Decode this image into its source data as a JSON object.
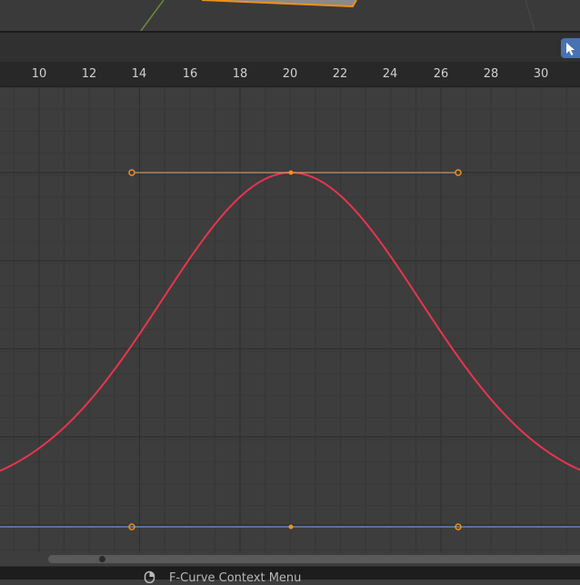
{
  "header": {
    "active_tool": "select-box"
  },
  "frame_ruler": {
    "labels": [
      "10",
      "12",
      "14",
      "16",
      "18",
      "20",
      "22",
      "24",
      "26",
      "28",
      "30"
    ]
  },
  "graph": {
    "fcurve_color": "#e8344f",
    "handle_color": "#f0901c",
    "second_curve_color": "#5a86bf"
  },
  "status_bar": {
    "hint": "F-Curve Context Menu",
    "icon": "mouse-right-icon"
  }
}
